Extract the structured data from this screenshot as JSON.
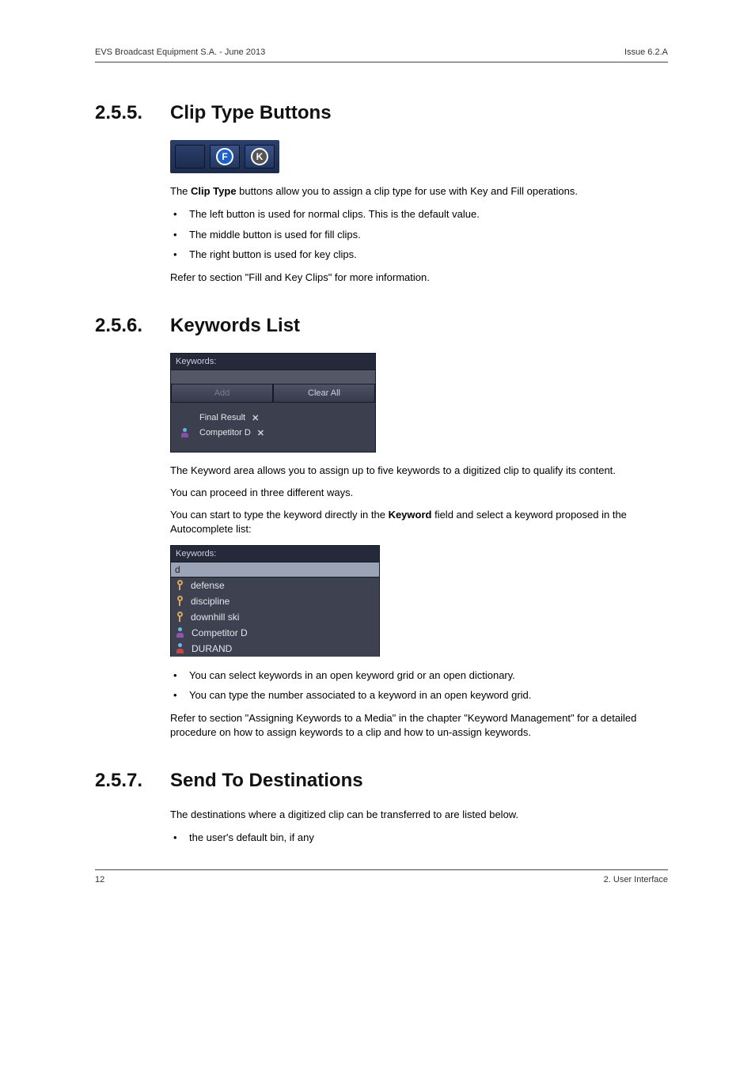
{
  "header": {
    "left": "EVS Broadcast Equipment S.A. - June 2013",
    "right": "Issue 6.2.A"
  },
  "footer": {
    "left": "12",
    "right": "2. User Interface"
  },
  "s255": {
    "num": "2.5.5.",
    "title": "Clip Type Buttons",
    "fig": {
      "f_label": "F",
      "k_label": "K"
    },
    "p1_a": "The ",
    "p1_b": "Clip Type",
    "p1_c": " buttons allow you to assign a clip type for use with Key and Fill operations.",
    "bullets": [
      "The left button is used for normal clips. This is the default value.",
      "The middle button is used for fill clips.",
      "The right button is used for key clips."
    ],
    "p2": "Refer to section \"Fill and Key Clips\" for more information."
  },
  "s256": {
    "num": "2.5.6.",
    "title": "Keywords List",
    "fig2": {
      "hdr": "Keywords:",
      "add": "Add",
      "clear": "Clear All",
      "items": [
        {
          "label": "Final Result",
          "person": false
        },
        {
          "label": "Competitor D",
          "person": true
        }
      ]
    },
    "p1": "The Keyword area allows you to assign up to five keywords to a digitized clip to qualify its content.",
    "p2": "You can proceed in three different ways.",
    "p3_a": "You can start to type the keyword directly in the ",
    "p3_b": "Keyword",
    "p3_c": " field and select a keyword proposed in the Autocomplete list:",
    "fig3": {
      "hdr": "Keywords:",
      "typed": "d",
      "items": [
        {
          "icon": "key",
          "label": "defense"
        },
        {
          "icon": "key",
          "label": "discipline"
        },
        {
          "icon": "key",
          "label": "downhill ski"
        },
        {
          "icon": "person-a",
          "label": "Competitor D"
        },
        {
          "icon": "person-b",
          "label": "DURAND"
        }
      ]
    },
    "bullets2": [
      "You can select keywords in an open keyword grid or an open dictionary.",
      "You can type the number associated to a keyword in an open keyword grid."
    ],
    "p4": "Refer to section \"Assigning Keywords to a Media\" in the chapter \"Keyword Management\" for a detailed procedure on how to assign keywords to a clip and how to un-assign keywords."
  },
  "s257": {
    "num": "2.5.7.",
    "title": "Send To Destinations",
    "p1": "The destinations where a digitized clip can be transferred to are listed below.",
    "bullets": [
      "the user's default bin, if any"
    ]
  }
}
